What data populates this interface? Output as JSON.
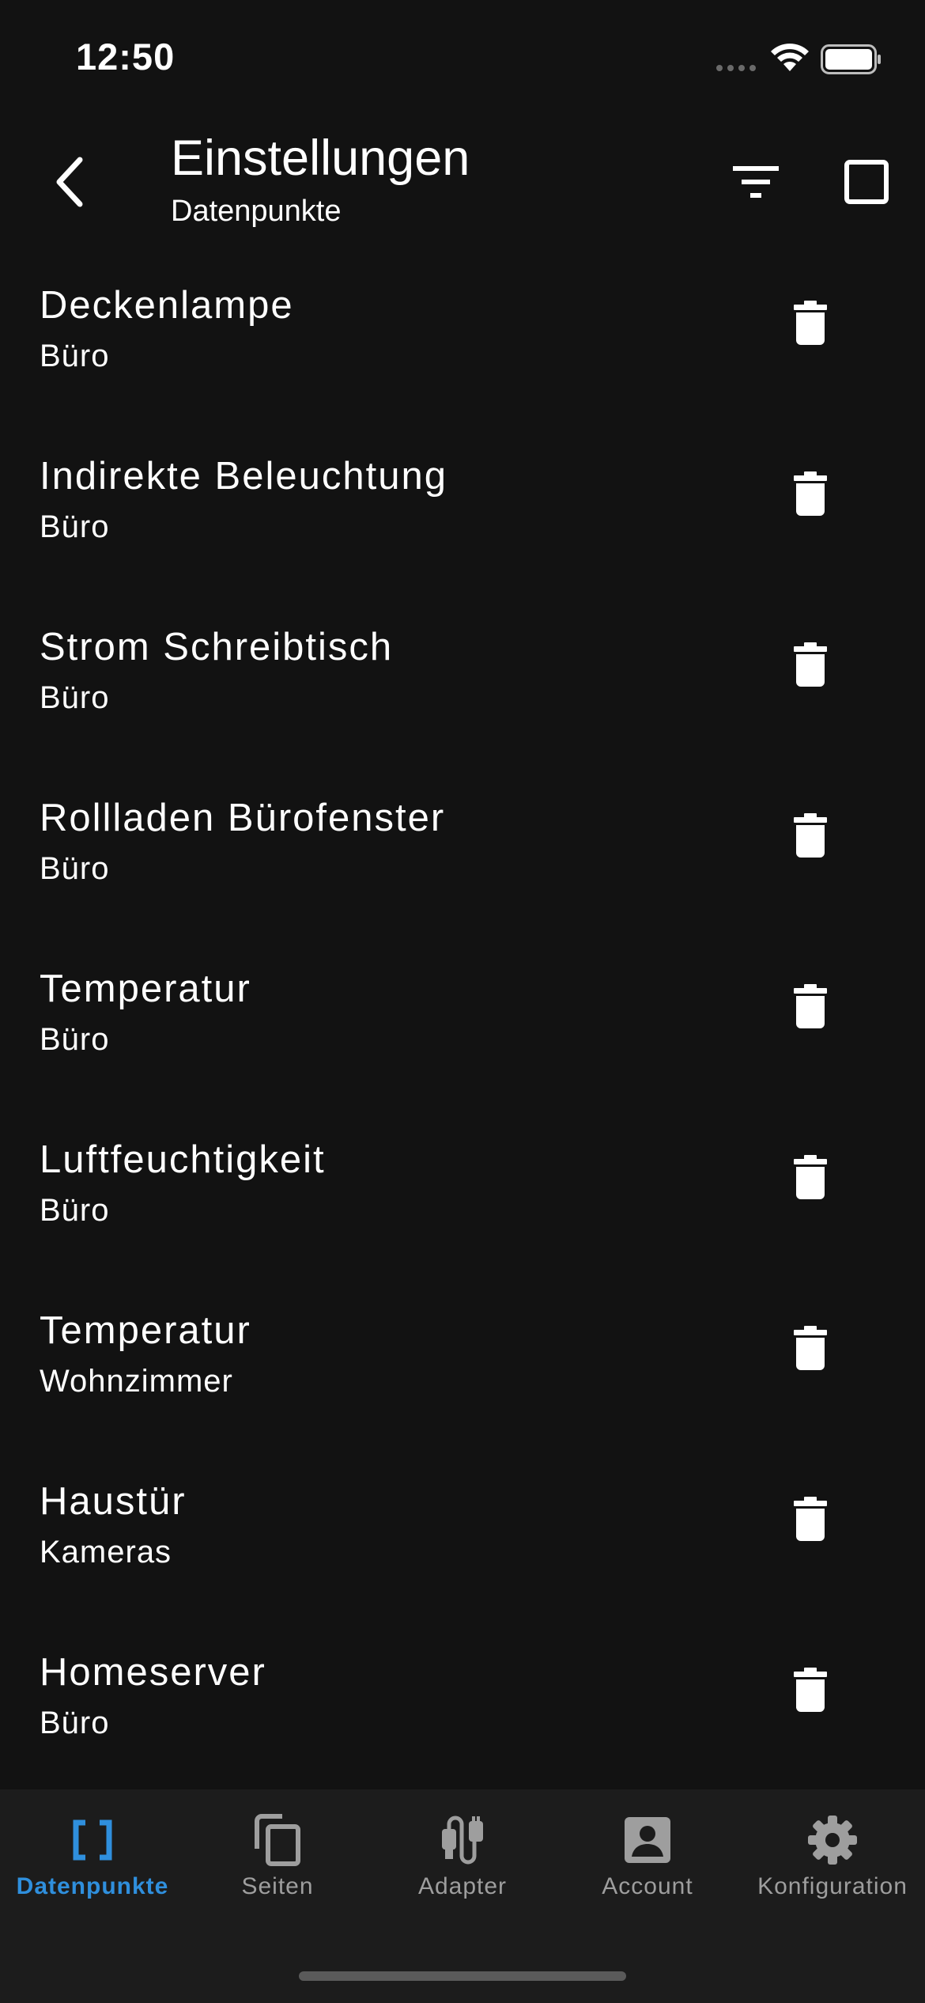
{
  "status_bar": {
    "time": "12:50"
  },
  "header": {
    "title": "Einstellungen",
    "subtitle": "Datenpunkte"
  },
  "datapoints": [
    {
      "name": "Deckenlampe",
      "room": "Büro"
    },
    {
      "name": "Indirekte Beleuchtung",
      "room": "Büro"
    },
    {
      "name": "Strom Schreibtisch",
      "room": "Büro"
    },
    {
      "name": "Rollladen Bürofenster",
      "room": "Büro"
    },
    {
      "name": "Temperatur",
      "room": "Büro"
    },
    {
      "name": "Luftfeuchtigkeit",
      "room": "Büro"
    },
    {
      "name": "Temperatur",
      "room": "Wohnzimmer"
    },
    {
      "name": "Haustür",
      "room": "Kameras"
    },
    {
      "name": "Homeserver",
      "room": "Büro"
    }
  ],
  "tabs": [
    {
      "label": "Datenpunkte",
      "icon": "brackets-icon",
      "active": true
    },
    {
      "label": "Seiten",
      "icon": "copy-pages-icon",
      "active": false
    },
    {
      "label": "Adapter",
      "icon": "plug-icon",
      "active": false
    },
    {
      "label": "Account",
      "icon": "account-box-icon",
      "active": false
    },
    {
      "label": "Konfiguration",
      "icon": "gear-icon",
      "active": false
    }
  ],
  "colors": {
    "background": "#121212",
    "tab_bar": "#1c1c1c",
    "accent": "#2f8fdd",
    "inactive": "#9e9e9e"
  }
}
